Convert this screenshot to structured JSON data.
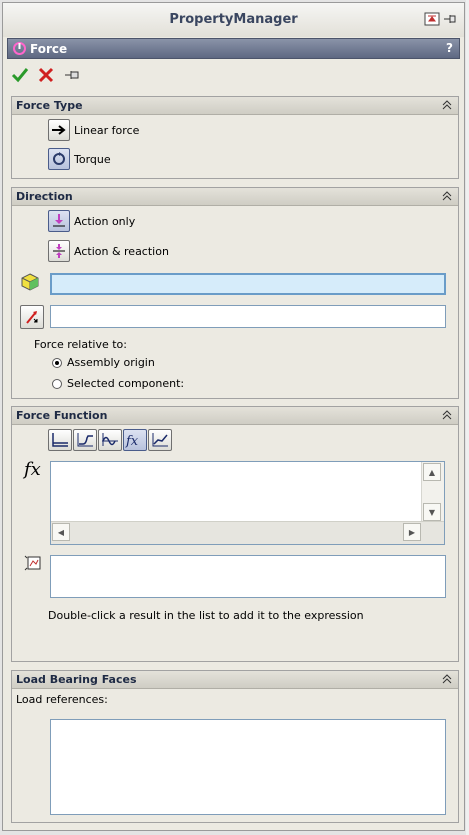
{
  "panel": {
    "title": "PropertyManager"
  },
  "feature": {
    "title": "Force",
    "help": "?"
  },
  "actions": {
    "ok": "ok-checkmark",
    "cancel": "cancel-x",
    "pin": "push-pin"
  },
  "force_type": {
    "title": "Force Type",
    "options": [
      {
        "label": "Linear force",
        "icon": "linear-force-arrow",
        "selected": false
      },
      {
        "label": "Torque",
        "icon": "torque-circle",
        "selected": true
      }
    ]
  },
  "direction": {
    "title": "Direction",
    "options": [
      {
        "label": "Action only",
        "icon": "action-only",
        "selected": true
      },
      {
        "label": "Action & reaction",
        "icon": "action-reaction",
        "selected": false
      }
    ],
    "relative_label": "Force relative to:",
    "radios": [
      {
        "label": "Assembly origin",
        "checked": true
      },
      {
        "label": "Selected component:",
        "checked": false
      }
    ]
  },
  "force_function": {
    "title": "Force Function",
    "function_buttons": [
      "constant",
      "step",
      "harmonic",
      "expression",
      "data-points"
    ],
    "fx_symbol": "fx",
    "hint": "Double-click a result in the list to add it to the expression"
  },
  "load_bearing": {
    "title": "Load Bearing Faces",
    "references_label": "Load references:"
  }
}
